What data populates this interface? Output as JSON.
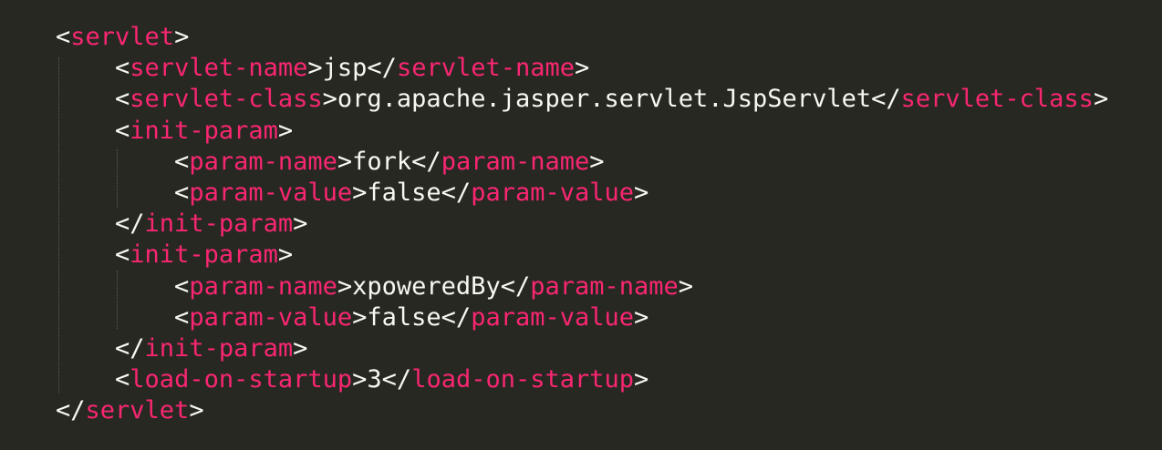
{
  "editor": {
    "colors": {
      "background": "#272822",
      "tag": "#f92672",
      "text": "#f8f8f2",
      "indent_guide": "#5a5b52"
    },
    "lines": [
      {
        "indent": 0,
        "kind": "open",
        "tag": "servlet"
      },
      {
        "indent": 1,
        "kind": "element",
        "tag": "servlet-name",
        "text": "jsp"
      },
      {
        "indent": 1,
        "kind": "element",
        "tag": "servlet-class",
        "text": "org.apache.jasper.servlet.JspServlet"
      },
      {
        "indent": 1,
        "kind": "open",
        "tag": "init-param"
      },
      {
        "indent": 2,
        "kind": "element",
        "tag": "param-name",
        "text": "fork"
      },
      {
        "indent": 2,
        "kind": "element",
        "tag": "param-value",
        "text": "false"
      },
      {
        "indent": 1,
        "kind": "close",
        "tag": "init-param"
      },
      {
        "indent": 1,
        "kind": "open",
        "tag": "init-param"
      },
      {
        "indent": 2,
        "kind": "element",
        "tag": "param-name",
        "text": "xpoweredBy"
      },
      {
        "indent": 2,
        "kind": "element",
        "tag": "param-value",
        "text": "false"
      },
      {
        "indent": 1,
        "kind": "close",
        "tag": "init-param"
      },
      {
        "indent": 1,
        "kind": "element",
        "tag": "load-on-startup",
        "text": "3"
      },
      {
        "indent": 0,
        "kind": "close",
        "tag": "servlet"
      }
    ]
  }
}
